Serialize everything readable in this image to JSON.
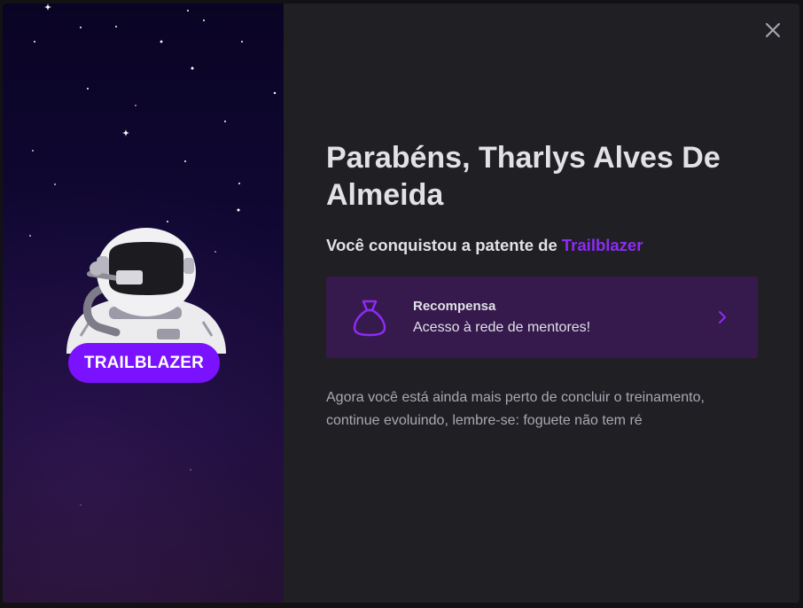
{
  "modal": {
    "badge": {
      "label": "TRAILBLAZER",
      "icon": "astronaut-icon",
      "accent": "#7a12ff"
    },
    "title": "Parabéns, Tharlys Alves De Almeida",
    "subtitle_prefix": "Você conquistou a patente de ",
    "rank_name": "Trailblazer",
    "rank_color": "#8c2cf2",
    "reward": {
      "icon": "money-bag-icon",
      "title": "Recompensa",
      "description": "Acesso à rede de mentores!",
      "action_icon": "chevron-right-icon",
      "background": "#361a4e"
    },
    "description": "Agora você está ainda mais perto de concluir o treinamento, continue evoluindo, lembre-se: foguete não tem ré",
    "close_icon": "close-icon"
  }
}
